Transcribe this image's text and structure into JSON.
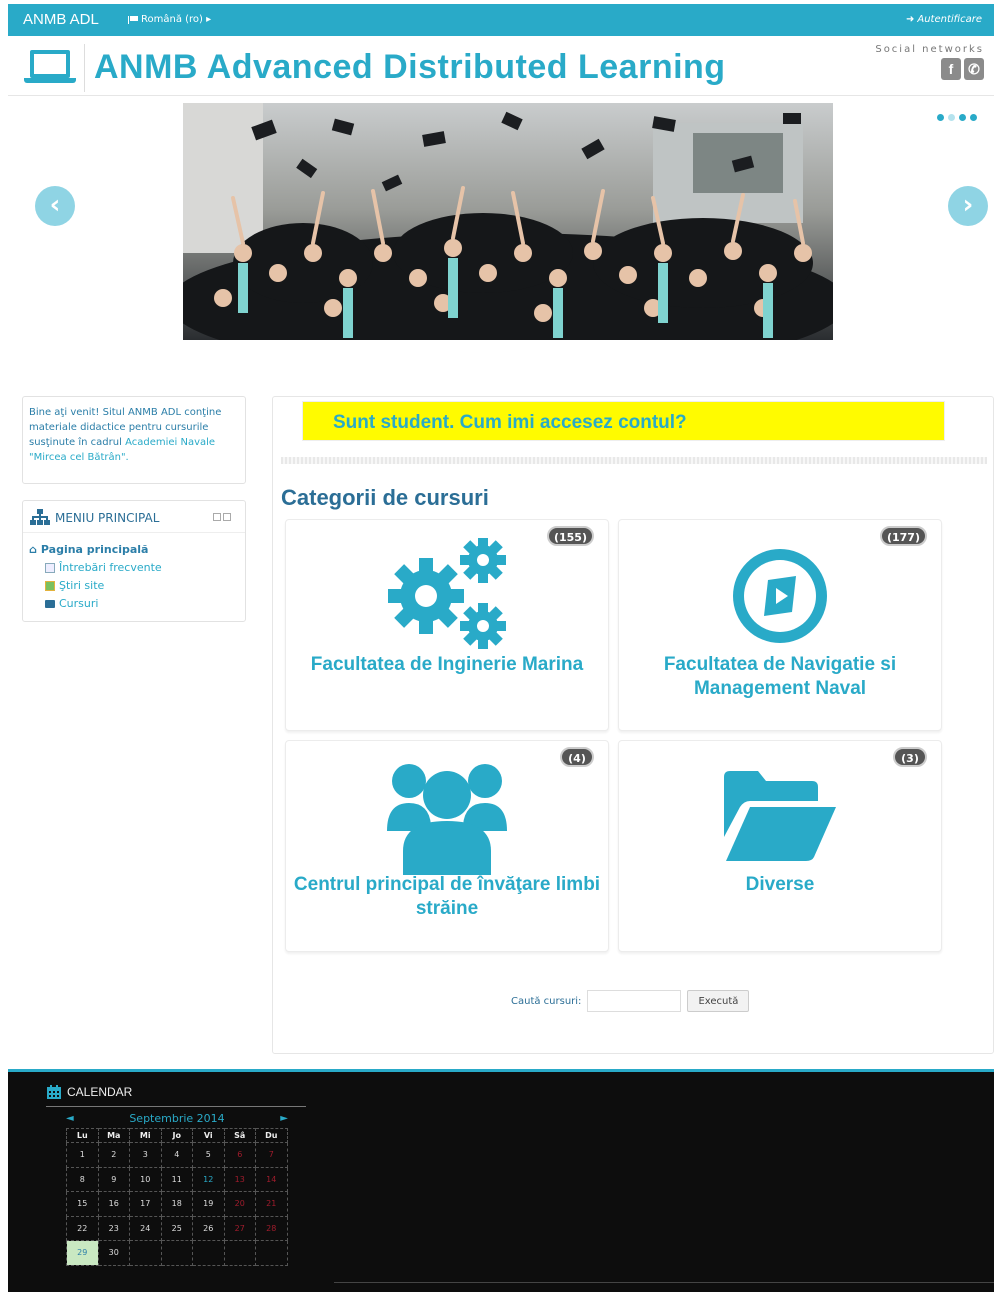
{
  "topbar": {
    "brand": "ANMB ADL",
    "language": "Română (ro) ▸",
    "login": "Autentificare"
  },
  "header": {
    "title": "ANMB Advanced Distributed Learning",
    "social_label": "Social networks",
    "social": [
      "f",
      "✆"
    ]
  },
  "colors": {
    "accent": "#29aac8",
    "banner": "#fffb00",
    "footer": "#0d0d0d",
    "weekend": "#a01c2c"
  },
  "welcome": {
    "text": "Bine aţi venit! Situl ANMB ADL conţine materiale didactice pentru cursurile susţinute în cadrul",
    "link": "Academiei Navale \"Mircea cel Bătrân\"."
  },
  "menu": {
    "title": "MENIU PRINCIPAL",
    "home": "Pagina principală",
    "items": [
      "Întrebări frecvente",
      "Ştiri site",
      "Cursuri"
    ]
  },
  "main": {
    "banner": "Sunt student. Cum imi accesez contul?",
    "categories_title": "Categorii de cursuri",
    "categories": [
      {
        "name": "Facultatea de Inginerie Marina",
        "count": "(155)",
        "icon": "gears-icon"
      },
      {
        "name": "Facultatea de Navigatie si Management Naval",
        "count": "(177)",
        "icon": "compass-icon"
      },
      {
        "name": "Centrul principal de învăţare limbi străine",
        "count": "(4)",
        "icon": "group-icon"
      },
      {
        "name": "Diverse",
        "count": "(3)",
        "icon": "folder-icon"
      }
    ],
    "search_label": "Caută cursuri:",
    "search_value": "",
    "search_button": "Execută"
  },
  "calendar": {
    "title": "CALENDAR",
    "month": "Septembrie 2014",
    "prev": "◄",
    "next": "►",
    "days": [
      "Lu",
      "Ma",
      "Mi",
      "Jo",
      "Vi",
      "Sâ",
      "Du"
    ],
    "weeks": [
      [
        "1",
        "2",
        "3",
        "4",
        "5",
        "6",
        "7"
      ],
      [
        "8",
        "9",
        "10",
        "11",
        "12",
        "13",
        "14"
      ],
      [
        "15",
        "16",
        "17",
        "18",
        "19",
        "20",
        "21"
      ],
      [
        "22",
        "23",
        "24",
        "25",
        "26",
        "27",
        "28"
      ],
      [
        "29",
        "30",
        "",
        "",
        "",
        "",
        ""
      ]
    ],
    "highlight_day": "12",
    "today": "29"
  },
  "slider": {
    "slides": 4,
    "active": 1
  }
}
